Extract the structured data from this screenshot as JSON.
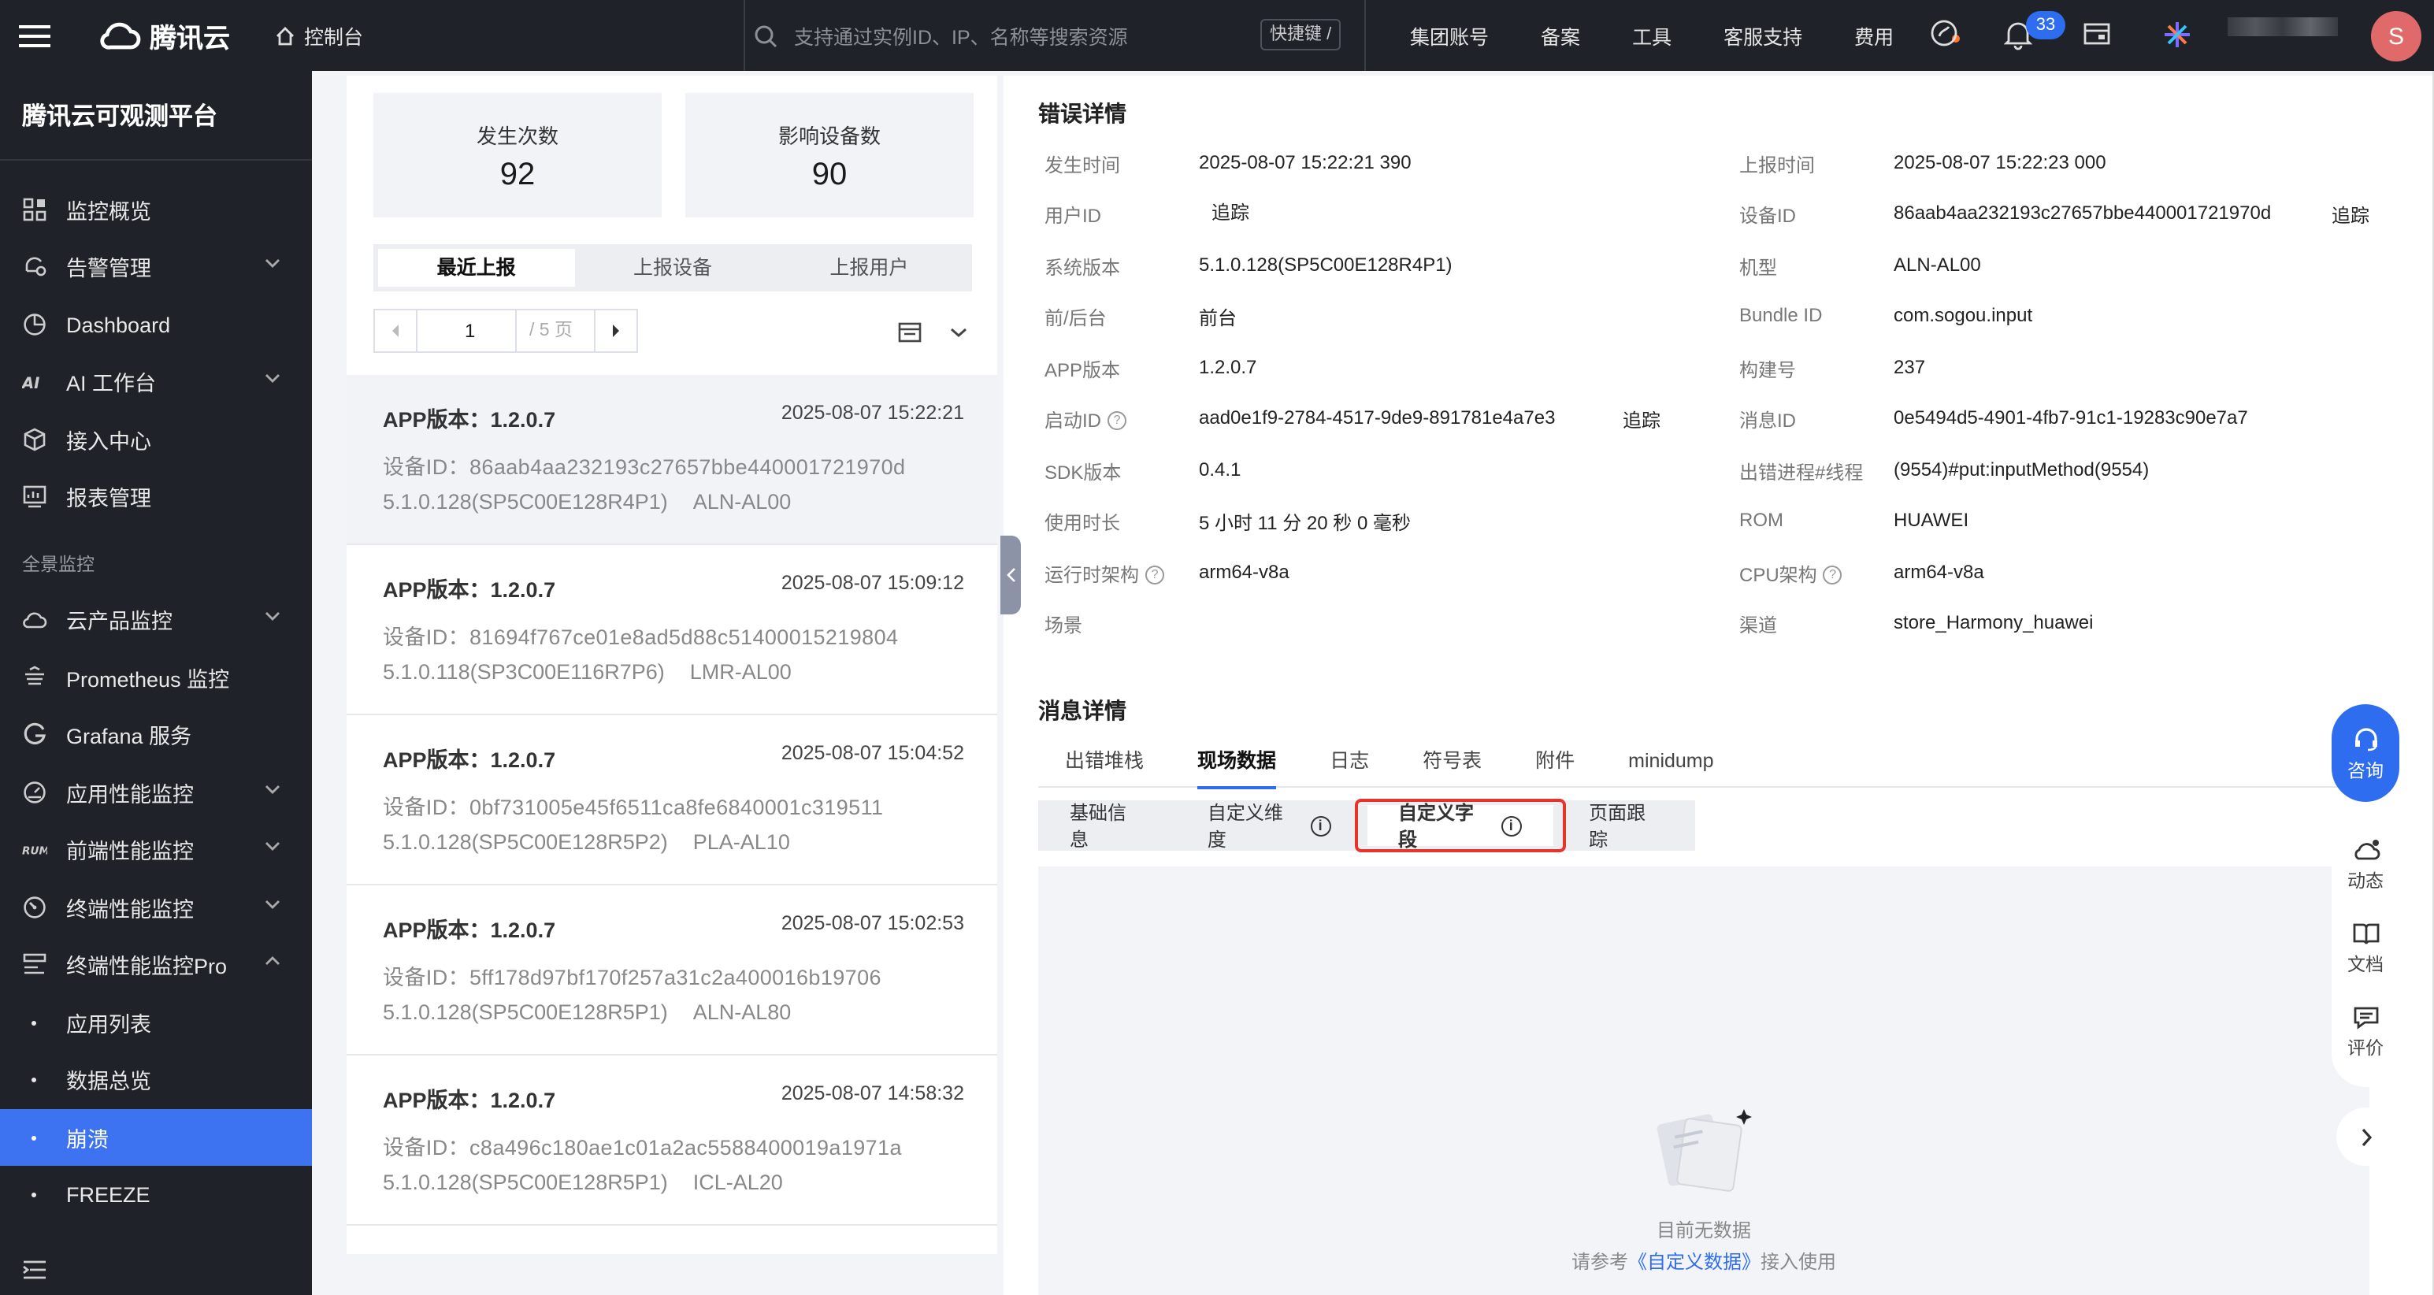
{
  "topbar": {
    "brand": "腾讯云",
    "console": "控制台",
    "search_placeholder": "支持通过实例ID、IP、名称等搜索资源",
    "shortcut": "快捷键 /",
    "nav": [
      "集团账号",
      "备案",
      "工具",
      "客服支持",
      "费用"
    ],
    "notifications": "33",
    "avatar": "S"
  },
  "sidebar": {
    "platform_title": "腾讯云可观测平台",
    "items": [
      {
        "label": "监控概览",
        "icon": "grid-icon"
      },
      {
        "label": "告警管理",
        "icon": "bell-gear-icon",
        "expandable": true
      },
      {
        "label": "Dashboard",
        "icon": "pie-icon"
      },
      {
        "label": "AI 工作台",
        "icon": "ai-icon",
        "expandable": true
      },
      {
        "label": "接入中心",
        "icon": "cube-icon"
      },
      {
        "label": "报表管理",
        "icon": "report-icon"
      }
    ],
    "group_label": "全景监控",
    "items2": [
      {
        "label": "云产品监控",
        "icon": "cloud-icon",
        "expandable": true
      },
      {
        "label": "Prometheus 监控",
        "icon": "prometheus-icon"
      },
      {
        "label": "Grafana 服务",
        "icon": "grafana-icon"
      },
      {
        "label": "应用性能监控",
        "icon": "apm-icon",
        "expandable": true
      },
      {
        "label": "前端性能监控",
        "icon": "rum-icon",
        "expandable": true
      },
      {
        "label": "终端性能监控",
        "icon": "gauge-icon",
        "expandable": true
      },
      {
        "label": "终端性能监控Pro",
        "icon": "pro-icon",
        "expandable": true,
        "expanded": true
      }
    ],
    "sub_items": [
      "应用列表",
      "数据总览",
      "崩溃",
      "FREEZE"
    ],
    "active_sub": "崩溃"
  },
  "left": {
    "stats": [
      {
        "title": "发生次数",
        "value": "92"
      },
      {
        "title": "影响设备数",
        "value": "90"
      }
    ],
    "tabs": [
      "最近上报",
      "上报设备",
      "上报用户"
    ],
    "active_tab": "最近上报",
    "pager": {
      "page": "1",
      "total": "/ 5 页"
    },
    "records": [
      {
        "version": "APP版本：1.2.0.7",
        "time": "2025-08-07 15:22:21",
        "device": "设备ID：86aab4aa232193c27657bbe440001721970d",
        "system": "5.1.0.128(SP5C00E128R4P1)",
        "model": "ALN-AL00"
      },
      {
        "version": "APP版本：1.2.0.7",
        "time": "2025-08-07 15:09:12",
        "device": "设备ID：81694f767ce01e8ad5d88c51400015219804",
        "system": "5.1.0.118(SP3C00E116R7P6)",
        "model": "LMR-AL00"
      },
      {
        "version": "APP版本：1.2.0.7",
        "time": "2025-08-07 15:04:52",
        "device": "设备ID：0bf731005e45f6511ca8fe6840001c319511",
        "system": "5.1.0.128(SP5C00E128R5P2)",
        "model": "PLA-AL10"
      },
      {
        "version": "APP版本：1.2.0.7",
        "time": "2025-08-07 15:02:53",
        "device": "设备ID：5ff178d97bf170f257a31c2a400016b19706",
        "system": "5.1.0.128(SP5C00E128R5P1)",
        "model": "ALN-AL80"
      },
      {
        "version": "APP版本：1.2.0.7",
        "time": "2025-08-07 14:58:32",
        "device": "设备ID：c8a496c180ae1c01a2ac5588400019a1971a",
        "system": "5.1.0.128(SP5C00E128R5P1)",
        "model": "ICL-AL20"
      }
    ]
  },
  "detail": {
    "title": "错误详情",
    "trace_link": "追踪",
    "left_fields": [
      {
        "key": "发生时间",
        "value": "2025-08-07 15:22:21 390"
      },
      {
        "key": "用户ID",
        "value": ""
      },
      {
        "key": "系统版本",
        "value": "5.1.0.128(SP5C00E128R4P1)"
      },
      {
        "key": "前/后台",
        "value": "前台"
      },
      {
        "key": "APP版本",
        "value": "1.2.0.7"
      },
      {
        "key": "启动ID",
        "value": "aad0e1f9-2784-4517-9de9-891781e4a7e3"
      },
      {
        "key": "SDK版本",
        "value": "0.4.1"
      },
      {
        "key": "使用时长",
        "value": "5 小时 11 分 20 秒 0 毫秒"
      },
      {
        "key": "运行时架构",
        "value": "arm64-v8a"
      },
      {
        "key": "场景",
        "value": ""
      }
    ],
    "right_fields": [
      {
        "key": "上报时间",
        "value": "2025-08-07 15:22:23 000"
      },
      {
        "key": "设备ID",
        "value": "86aab4aa232193c27657bbe440001721970d"
      },
      {
        "key": "机型",
        "value": "ALN-AL00"
      },
      {
        "key": "Bundle ID",
        "value": "com.sogou.input"
      },
      {
        "key": "构建号",
        "value": "237"
      },
      {
        "key": "消息ID",
        "value": "0e5494d5-4901-4fb7-91c1-19283c90e7a7"
      },
      {
        "key": "出错进程#线程",
        "value": "(9554)#put:inputMethod(9554)"
      },
      {
        "key": "ROM",
        "value": "HUAWEI"
      },
      {
        "key": "CPU架构",
        "value": "arm64-v8a"
      },
      {
        "key": "渠道",
        "value": "store_Harmony_huawei"
      }
    ]
  },
  "message": {
    "title": "消息详情",
    "tabs": [
      "出错堆栈",
      "现场数据",
      "日志",
      "符号表",
      "附件",
      "minidump"
    ],
    "active_tab": "现场数据",
    "subtabs": [
      "基础信息",
      "自定义维度",
      "自定义字段",
      "页面跟踪"
    ],
    "active_subtab": "自定义字段",
    "empty_text": "目前无数据",
    "empty_hint_prefix": "请参考",
    "empty_hint_link": "《自定义数据》",
    "empty_hint_suffix": "接入使用"
  },
  "float": {
    "consult": "咨询",
    "items": [
      "动态",
      "文档",
      "评价"
    ]
  }
}
